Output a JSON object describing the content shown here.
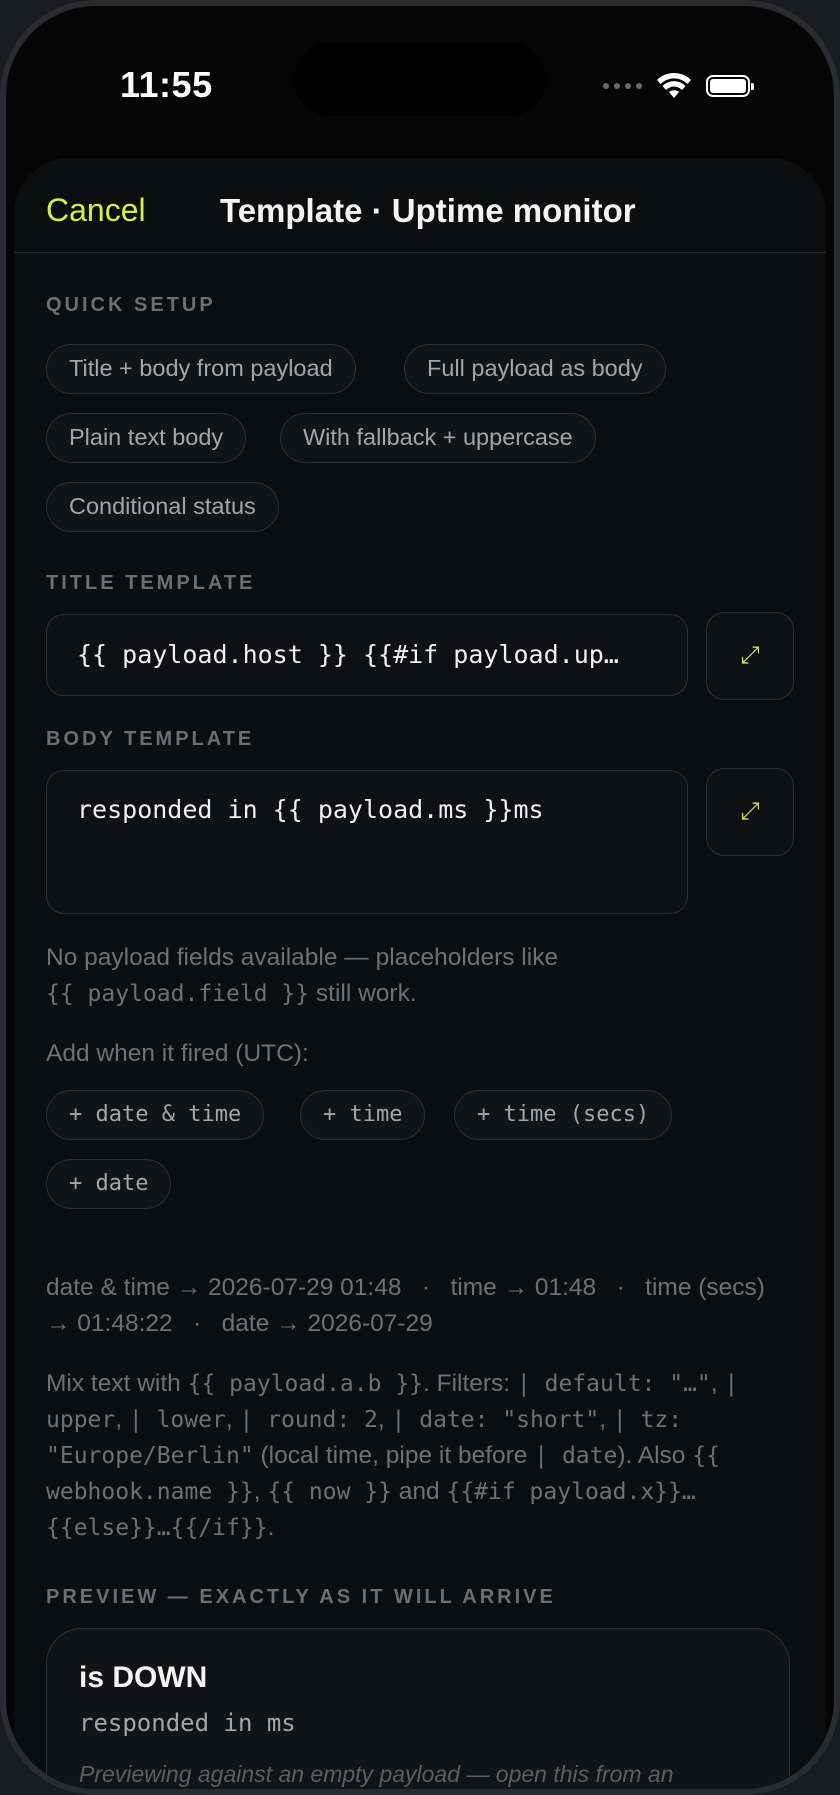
{
  "status_bar": {
    "time": "11:55"
  },
  "nav": {
    "cancel_label": "Cancel",
    "title": "Template · Uptime monitor"
  },
  "quick_setup": {
    "label": "QUICK SETUP",
    "chips": [
      "Title + body from payload",
      "Full payload as body",
      "Plain text body",
      "With fallback + uppercase",
      "Conditional status"
    ]
  },
  "title_template": {
    "label": "TITLE TEMPLATE",
    "value": "{{ payload.host }} {{#if payload.up…",
    "expand_glyph": "⤢"
  },
  "body_template": {
    "label": "BODY TEMPLATE",
    "value": "responded in {{ payload.ms }}ms",
    "expand_glyph": "⤢"
  },
  "no_fields_note": {
    "text": "No payload fields available — placeholders like",
    "code": "{{ payload.field }}",
    "suffix": " still work."
  },
  "timestamp": {
    "label": "Add when it fired (UTC):",
    "chips": [
      "+ date & time",
      "+ time",
      "+ time (secs)",
      "+ date"
    ],
    "examples": "date & time → 2026-07-29 01:48   ·   time → 01:48   ·   time (secs) → 01:48:22   ·   date → 2026-07-29"
  },
  "filters_help": {
    "p1": "Mix text with ",
    "c1": "{{ payload.a.b }}",
    "p2": ". Filters: ",
    "c2": "| default: \"…\"",
    "p3": ", ",
    "c3": "| upper",
    "p4": ", ",
    "c4": "| lower",
    "p5": ", ",
    "c5": "| round: 2",
    "p6": ", ",
    "c6": "| date: \"short\"",
    "p7": ", ",
    "c7": "| tz: \"Europe/Berlin\"",
    "p8": " (local time, pipe it before ",
    "c8": "| date",
    "p9": "). Also ",
    "c9": "{{ webhook.name }}",
    "p10": ", ",
    "c10": "{{ now }}",
    "p11": " and ",
    "c11": "{{#if payload.x}}…{{else}}…{{/if}}",
    "p12": "."
  },
  "preview": {
    "label": "PREVIEW — EXACTLY AS IT WILL ARRIVE",
    "title": "is DOWN",
    "body": "responded in ms",
    "note": "Previewing against an empty payload — open this from an"
  },
  "colors": {
    "accent": "#d4f23b",
    "background": "#0c0d0f"
  }
}
